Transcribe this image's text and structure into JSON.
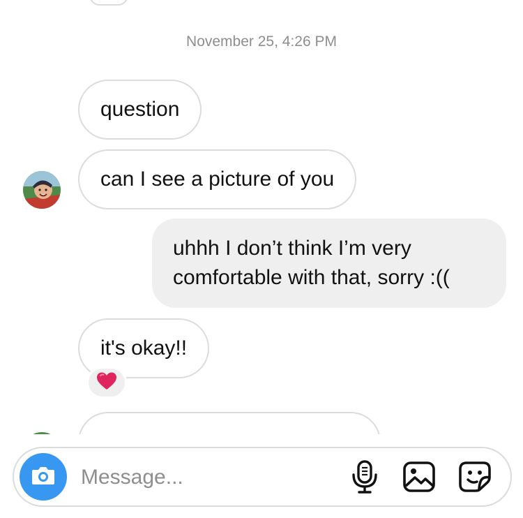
{
  "thread": {
    "timestamp": "November 25, 4:26 PM",
    "messages": [
      {
        "text": "question"
      },
      {
        "text": "can I see a picture of you"
      },
      {
        "text": "uhhh I don’t think I’m very comfortable with that, sorry :(("
      },
      {
        "text": "it's okay!!"
      }
    ],
    "reaction": "❤️"
  },
  "composer": {
    "placeholder": "Message...",
    "icons": [
      "camera-icon",
      "microphone-icon",
      "gallery-icon",
      "sticker-icon"
    ]
  },
  "colors": {
    "camera_button": "#3897f0",
    "outgoing_bubble": "#efefef",
    "incoming_border": "#dcdcdc",
    "timestamp": "#8e8e8e"
  }
}
